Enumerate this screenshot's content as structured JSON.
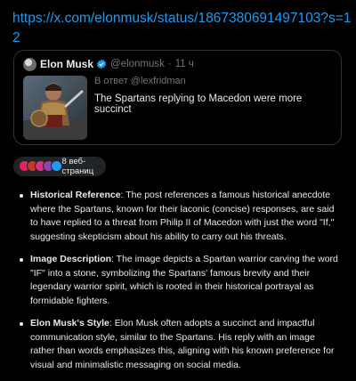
{
  "link": {
    "url": "https://x.com/elonmusk/status/1867380691497103?s=12"
  },
  "tweet": {
    "author": "Elon Musk",
    "handle": "@elonmusk",
    "time_sep": "·",
    "time": "11 ч",
    "reply_to": "В ответ @lexfridman",
    "text": "The Spartans replying to Macedon were more succinct",
    "icons": {
      "verified": "verified-badge-icon",
      "avatar": "avatar-image",
      "image": "spartan-warrior-image"
    },
    "colors": {
      "verified": "#1d9bf0"
    }
  },
  "sources": {
    "label": "8 веб-страниц",
    "favicons": [
      {
        "color": "#e0245e"
      },
      {
        "color": "#c0392b"
      },
      {
        "color": "#d63384"
      },
      {
        "color": "#8e44ad"
      },
      {
        "color": "#1d9bf0"
      }
    ]
  },
  "bullets": [
    {
      "title": "Historical Reference",
      "text": ": The post references a famous historical anecdote where the Spartans, known for their laconic (concise) responses, are said to have replied to a threat from Philip II of Macedon with just the word \"If,\" suggesting skepticism about his ability to carry out his threats."
    },
    {
      "title": "Image Description",
      "text": ": The image depicts a Spartan warrior carving the word \"IF\" into a stone, symbolizing the Spartans' famous brevity and their legendary warrior spirit, which is rooted in their historical portrayal as formidable fighters."
    },
    {
      "title": "Elon Musk's Style",
      "text": ": Elon Musk often adopts a succinct and impactful communication style, similar to the Spartans. His reply with an image rather than words emphasizes this, aligning with his known preference for visual and minimalistic messaging on social media."
    }
  ],
  "colors": {
    "background": "#000000",
    "link": "#1d9bf0",
    "muted": "#71767b",
    "border": "#2f3336"
  }
}
